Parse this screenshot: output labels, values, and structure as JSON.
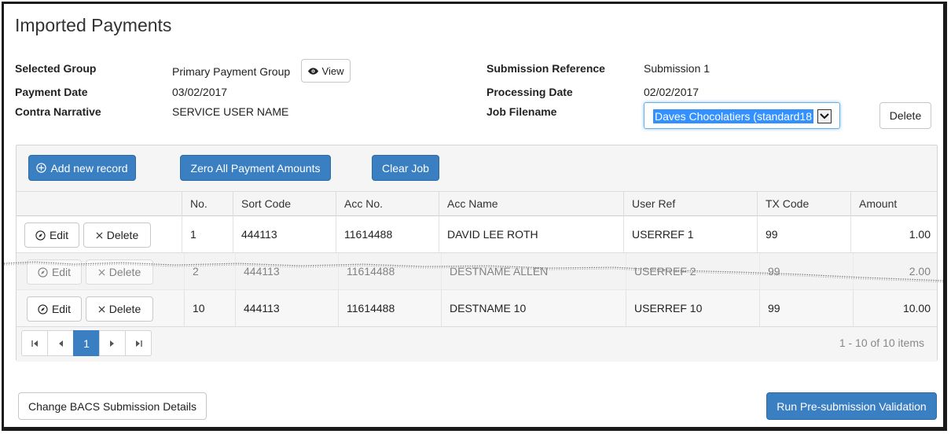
{
  "page": {
    "title": "Imported Payments"
  },
  "details": {
    "selected_group_label": "Selected Group",
    "selected_group_value": "Primary Payment Group",
    "view_label": "View",
    "payment_date_label": "Payment Date",
    "payment_date_value": "03/02/2017",
    "contra_narrative_label": "Contra Narrative",
    "contra_narrative_value": "SERVICE USER NAME",
    "submission_reference_label": "Submission Reference",
    "submission_reference_value": "Submission 1",
    "processing_date_label": "Processing Date",
    "processing_date_value": "02/02/2017",
    "job_filename_label": "Job Filename",
    "job_filename_value": "Daves Chocolatiers (standard18",
    "delete_label": "Delete"
  },
  "toolbar": {
    "add_label": "Add new record",
    "zero_label": "Zero All Payment Amounts",
    "clear_label": "Clear Job"
  },
  "table": {
    "columns": [
      "No.",
      "Sort Code",
      "Acc No.",
      "Acc Name",
      "User Ref",
      "TX Code",
      "Amount"
    ],
    "edit_label": "Edit",
    "delete_label": "Delete",
    "rows": [
      {
        "no": "1",
        "sort_code": "444113",
        "acc_no": "11614488",
        "acc_name": "DAVID LEE ROTH",
        "user_ref": "USERREF 1",
        "tx_code": "99",
        "amount": "1.00"
      },
      {
        "no": "2",
        "sort_code": "444113",
        "acc_no": "11614488",
        "acc_name": "DESTNAME ALLEN",
        "user_ref": "USERREF 2",
        "tx_code": "99",
        "amount": "2.00"
      },
      {
        "no": "10",
        "sort_code": "444113",
        "acc_no": "11614488",
        "acc_name": "DESTNAME 10",
        "user_ref": "USERREF 10",
        "tx_code": "99",
        "amount": "10.00"
      }
    ]
  },
  "pager": {
    "current_page": "1",
    "info": "1 - 10 of 10 items"
  },
  "footer": {
    "change_label": "Change BACS Submission Details",
    "run_label": "Run Pre-submission Validation"
  },
  "colors": {
    "primary": "#3a7fc1",
    "selection": "#3390ff"
  }
}
